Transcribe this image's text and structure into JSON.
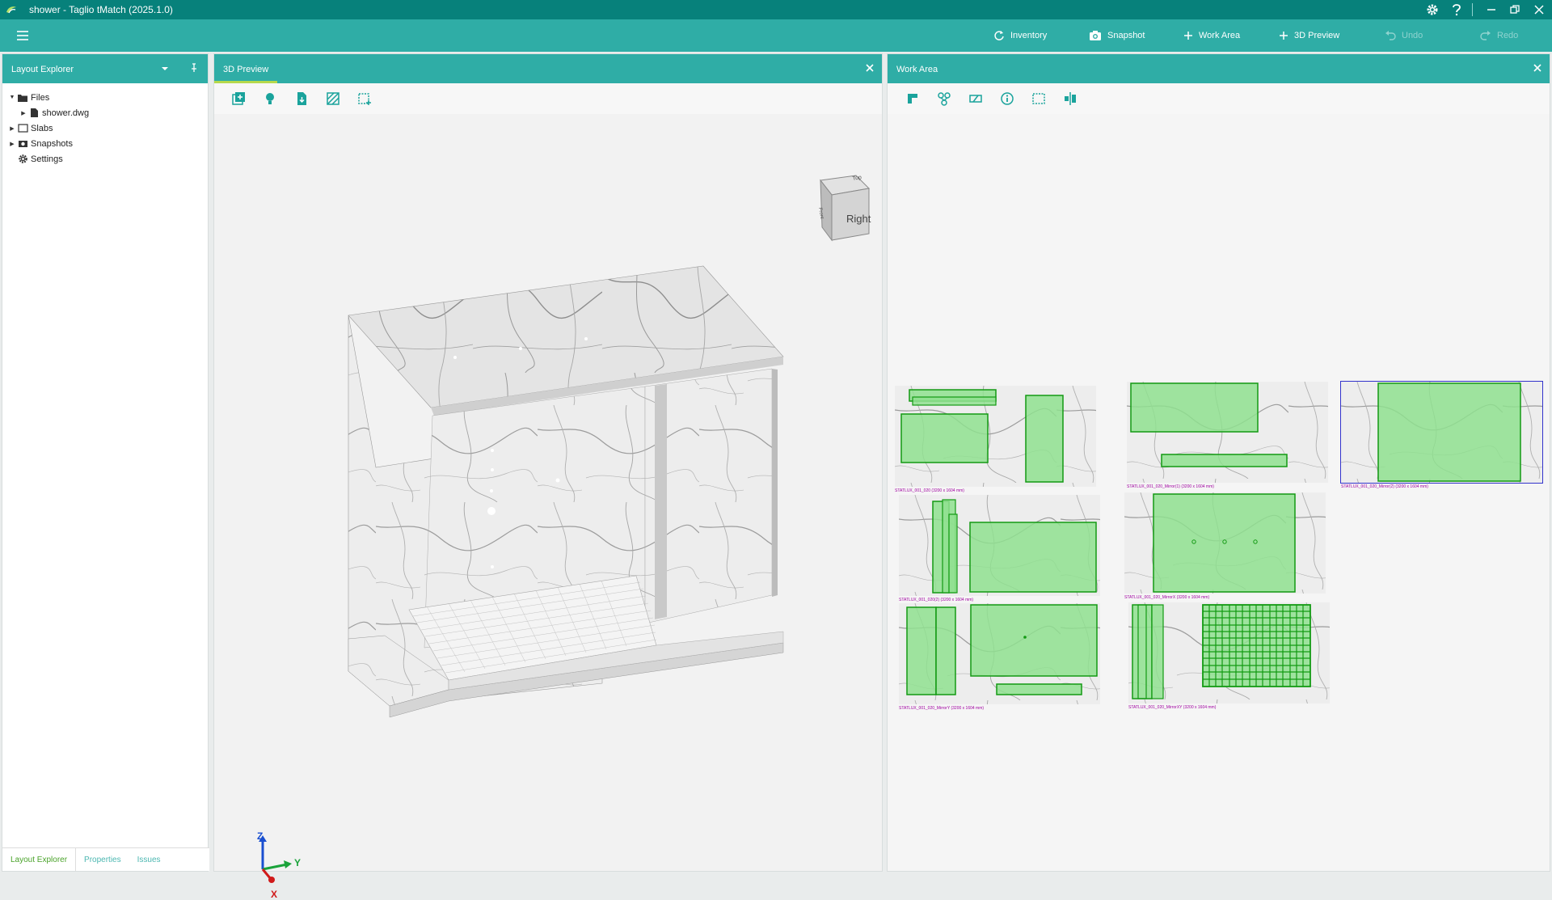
{
  "window": {
    "title": "shower - Taglio tMatch (2025.1.0)"
  },
  "toolbar": {
    "inventory": "Inventory",
    "snapshot": "Snapshot",
    "work_area": "Work Area",
    "preview_3d": "3D Preview",
    "undo": "Undo",
    "redo": "Redo"
  },
  "layout_explorer": {
    "title": "Layout Explorer",
    "tree": {
      "files": "Files",
      "file_dwg": "shower.dwg",
      "slabs": "Slabs",
      "snapshots": "Snapshots",
      "settings": "Settings"
    },
    "tabs": {
      "layout_explorer": "Layout Explorer",
      "properties": "Properties",
      "issues": "Issues"
    }
  },
  "preview": {
    "title": "3D Preview",
    "view_cube_label": "Right",
    "axes": {
      "x": "X",
      "y": "Y",
      "z": "Z"
    }
  },
  "work_area": {
    "title": "Work Area",
    "slabs": [
      {
        "label": "STATLUX_001_020 (3200 x 1604 mm)"
      },
      {
        "label": "STATLUX_001_020_Mirror(1) (3200 x 1604 mm)"
      },
      {
        "label": "STATLUX_001_020_Mirror(2) (3200 x 1604 mm)"
      },
      {
        "label": "STATLUX_001_020(2) (3200 x 1604 mm)"
      },
      {
        "label": "STATLUX_001_020_MirrorX (3200 x 1604 mm)"
      },
      {
        "label": "STATLUX_001_020_MirrorY (3200 x 1604 mm)"
      },
      {
        "label": "STATLUX_001_020_MirrorXY (3200 x 1604 mm)"
      }
    ]
  },
  "colors": {
    "titlebar": "#07817b",
    "accent": "#2fada6",
    "piece_fill": "#8fe08f",
    "piece_stroke": "#139a13",
    "selection": "#3333cc"
  }
}
